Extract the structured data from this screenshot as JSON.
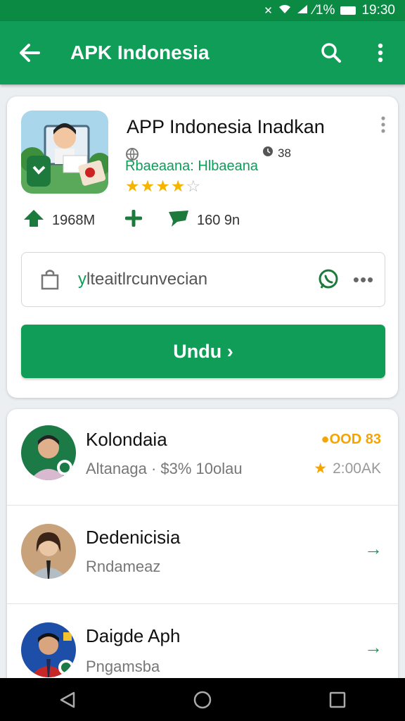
{
  "status_bar": {
    "signal_text": "⁄1%",
    "time": "19:30"
  },
  "app_bar": {
    "title": "APK Indonesia",
    "icons": [
      "back-arrow-icon",
      "search-icon",
      "more-vert-icon"
    ]
  },
  "app_card": {
    "name": "APP Indonesia Inadkan",
    "count": "38",
    "developer": "Rbaeaana: Hlbaeana",
    "rating_stars": 4,
    "rating_max": 5,
    "stats": {
      "size": "1968M",
      "reviews": "160 9n"
    },
    "info_text_prefix": "y",
    "info_text_rest": "lteaitlrcunvecian",
    "more": "•••",
    "download_label": "Undu ›"
  },
  "list": [
    {
      "title": "Kolondaia",
      "subtitle": "Altanaga · $3% 10olau",
      "right_top": "●OOD 83",
      "right_bottom": "2:00AK",
      "avatar_bg": "#1b7a45"
    },
    {
      "title": "Dedenicisia",
      "subtitle": "Rndameaz",
      "arrow": "→",
      "avatar_bg": "#c8a27a"
    },
    {
      "title": "Daigde Aph",
      "subtitle": "Pngamsba",
      "arrow": "→",
      "avatar_bg": "#1e4fa8"
    }
  ],
  "colors": {
    "primary": "#0f9d58",
    "status_bar": "#0b8a44",
    "star": "#f5b400"
  }
}
